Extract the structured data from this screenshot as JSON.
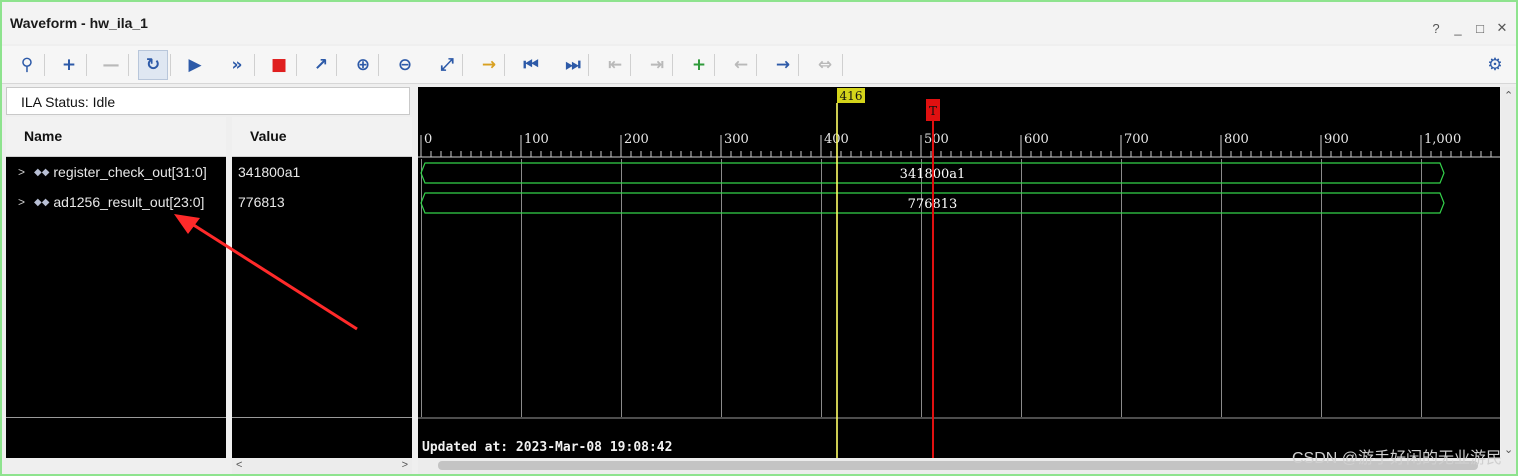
{
  "window": {
    "title": "Waveform - hw_ila_1",
    "controls": [
      "?",
      "_",
      "□",
      "✕"
    ]
  },
  "toolbar": [
    {
      "name": "search-icon",
      "glyph": "⚲",
      "state": "normal"
    },
    {
      "name": "add-icon",
      "glyph": "+",
      "state": "normal"
    },
    {
      "name": "remove-icon",
      "glyph": "—",
      "state": "disabled"
    },
    {
      "name": "run-trigger-immediate-icon",
      "glyph": "↻",
      "state": "selected"
    },
    {
      "name": "run-trigger-icon",
      "glyph": "▶",
      "state": "normal"
    },
    {
      "name": "run-trigger-repeat-icon",
      "glyph": "»",
      "state": "normal"
    },
    {
      "name": "stop-trigger-icon",
      "glyph": "■",
      "state": "normal"
    },
    {
      "name": "export-icon",
      "glyph": "↗",
      "state": "normal"
    },
    {
      "name": "zoom-in-icon",
      "glyph": "⊕",
      "state": "normal"
    },
    {
      "name": "zoom-out-icon",
      "glyph": "⊖",
      "state": "normal"
    },
    {
      "name": "zoom-fit-icon",
      "glyph": "⤢",
      "state": "normal"
    },
    {
      "name": "go-to-cursor-icon",
      "glyph": "→",
      "state": "normal"
    },
    {
      "name": "go-to-start-icon",
      "glyph": "⏮",
      "state": "normal"
    },
    {
      "name": "go-to-end-icon",
      "glyph": "⏭",
      "state": "normal"
    },
    {
      "name": "previous-transition-icon",
      "glyph": "⇤",
      "state": "disabled"
    },
    {
      "name": "next-transition-icon",
      "glyph": "⇥",
      "state": "disabled"
    },
    {
      "name": "add-marker-icon",
      "glyph": "+",
      "state": "normal"
    },
    {
      "name": "previous-marker-icon",
      "glyph": "←",
      "state": "disabled"
    },
    {
      "name": "next-marker-icon",
      "glyph": "→",
      "state": "normal"
    },
    {
      "name": "swap-cursors-icon",
      "glyph": "⇔",
      "state": "disabled"
    }
  ],
  "settings_icon": "⚙",
  "status": {
    "label": "ILA Status:",
    "value": "Idle"
  },
  "columns": {
    "name": "Name",
    "value": "Value"
  },
  "signals": [
    {
      "name": "register_check_out[31:0]",
      "value": "341800a1",
      "bus_text": "341800a1"
    },
    {
      "name": "ad1256_result_out[23:0]",
      "value": "776813",
      "bus_text": "776813"
    }
  ],
  "time_axis": {
    "ticks": [
      "0",
      "100",
      "200",
      "300",
      "400",
      "500",
      "600",
      "700",
      "800",
      "900",
      "1,000"
    ],
    "range": [
      0,
      1023
    ]
  },
  "cursor": {
    "label": "416",
    "color": "#ffff66",
    "position": 416
  },
  "trigger": {
    "label": "T",
    "color": "#e01010",
    "position": 512
  },
  "updated": "Updated at: 2023-Mar-08 19:08:42",
  "watermark": "CSDN @游手好闲的无业游民"
}
